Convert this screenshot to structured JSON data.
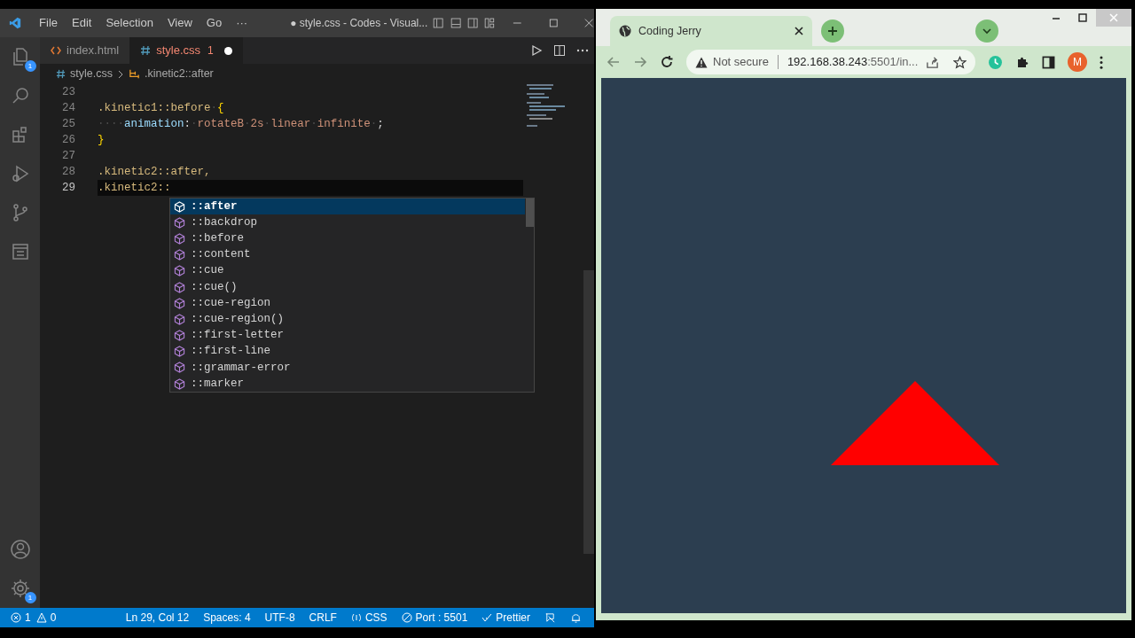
{
  "vscode": {
    "menu": [
      "File",
      "Edit",
      "Selection",
      "View",
      "Go",
      "···"
    ],
    "title": "● style.css - Codes - Visual...",
    "activity_badges": {
      "explorer": "1",
      "settings": "1"
    },
    "tabs": [
      {
        "label": "index.html",
        "kind": "html",
        "selected": false
      },
      {
        "label": "style.css",
        "kind": "css",
        "selected": true,
        "problems": "1",
        "dirty": true
      }
    ],
    "breadcrumb": [
      "style.css",
      ".kinetic2::after"
    ],
    "lines": [
      {
        "number": "23",
        "current": false
      },
      {
        "number": "24",
        "current": false,
        "tokens": [
          {
            "text": ".kinetic1::before",
            "kind": "selector"
          },
          {
            "text": "·",
            "kind": "ws"
          },
          {
            "text": "{",
            "kind": "brace"
          }
        ]
      },
      {
        "number": "25",
        "current": false,
        "tokens": [
          {
            "text": "····",
            "kind": "ws"
          },
          {
            "text": "animation",
            "kind": "prop"
          },
          {
            "text": ":",
            "kind": "punct"
          },
          {
            "text": "·",
            "kind": "ws"
          },
          {
            "text": "rotateB",
            "kind": "value"
          },
          {
            "text": "·",
            "kind": "ws"
          },
          {
            "text": "2s",
            "kind": "value"
          },
          {
            "text": "·",
            "kind": "ws"
          },
          {
            "text": "linear",
            "kind": "value"
          },
          {
            "text": "·",
            "kind": "ws"
          },
          {
            "text": "infinite",
            "kind": "value"
          },
          {
            "text": "·",
            "kind": "ws"
          },
          {
            "text": ";",
            "kind": "punct"
          }
        ]
      },
      {
        "number": "26",
        "current": false,
        "tokens": [
          {
            "text": "}",
            "kind": "brace"
          }
        ]
      },
      {
        "number": "27",
        "current": false
      },
      {
        "number": "28",
        "current": false,
        "tokens": [
          {
            "text": ".kinetic2::after,",
            "kind": "selector"
          }
        ]
      },
      {
        "number": "29",
        "current": true,
        "tokens": [
          {
            "text": ".kinetic2::",
            "kind": "selector"
          }
        ]
      }
    ],
    "suggestions": [
      {
        "label": "::after",
        "selected": true
      },
      {
        "label": "::backdrop",
        "selected": false
      },
      {
        "label": "::before",
        "selected": false
      },
      {
        "label": "::content",
        "selected": false
      },
      {
        "label": "::cue",
        "selected": false
      },
      {
        "label": "::cue()",
        "selected": false
      },
      {
        "label": "::cue-region",
        "selected": false
      },
      {
        "label": "::cue-region()",
        "selected": false
      },
      {
        "label": "::first-letter",
        "selected": false
      },
      {
        "label": "::first-line",
        "selected": false
      },
      {
        "label": "::grammar-error",
        "selected": false
      },
      {
        "label": "::marker",
        "selected": false
      }
    ],
    "status_bar": {
      "errors": "1",
      "warnings": "0",
      "items": [
        "Ln 29, Col 12",
        "Spaces: 4",
        "UTF-8",
        "CRLF",
        "CSS",
        "Port : 5501",
        "Prettier"
      ]
    }
  },
  "browser": {
    "tab": {
      "title": "Coding Jerry"
    },
    "not_secure": "Not secure",
    "url_host": "192.168.38.243",
    "url_rest": ":5501/in...",
    "avatar": "M"
  }
}
